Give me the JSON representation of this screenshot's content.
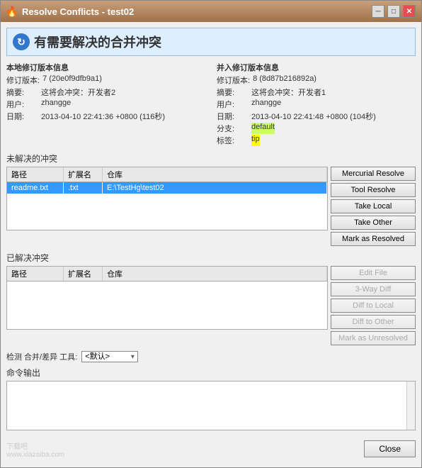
{
  "window": {
    "title": "Resolve Conflicts - test02",
    "minimize_label": "─",
    "maximize_label": "□",
    "close_label": "✕"
  },
  "header": {
    "icon": "↻",
    "title": "有需要解决的合并冲突"
  },
  "local_info": {
    "title": "本地修订版本信息",
    "revision_label": "修订版本:",
    "revision_value": "7 (20e0f9dfb9a1)",
    "summary_label": "摘要:",
    "summary_value": "这将会冲突：开发者2",
    "user_label": "用户:",
    "user_value": "zhangge",
    "date_label": "日期:",
    "date_value": "2013-04-10 22:41:36 +0800 (116秒)"
  },
  "merge_info": {
    "title": "并入修订版本信息",
    "revision_label": "修订版本:",
    "revision_value": "8 (8d87b216892a)",
    "summary_label": "摘要:",
    "summary_value": "这将会冲突：开发者1",
    "user_label": "用户:",
    "user_value": "zhangge",
    "date_label": "日期:",
    "date_value": "2013-04-10 22:41:48 +0800 (104秒)",
    "branch_label": "分支:",
    "branch_value": "default",
    "tag_label": "标签:",
    "tag_value": "tip"
  },
  "unresolved_section": {
    "label": "未解决的冲突",
    "table_headers": [
      "路径",
      "扩展名",
      "仓库"
    ],
    "rows": [
      {
        "path": "readme.txt",
        "ext": ".txt",
        "repo": "E:\\TestHg\\test02",
        "selected": true
      }
    ],
    "buttons": {
      "mercurial_resolve": "Mercurial Resolve",
      "tool_resolve": "Tool Resolve",
      "take_local": "Take Local",
      "take_other": "Take Other",
      "mark_resolved": "Mark as Resolved"
    }
  },
  "resolved_section": {
    "label": "已解决冲突",
    "table_headers": [
      "路径",
      "扩展名",
      "仓库"
    ],
    "rows": [],
    "buttons": {
      "edit_file": "Edit File",
      "three_way_diff": "3-Way Diff",
      "diff_to_local": "Diff to Local",
      "diff_to_other": "Diff to Other",
      "mark_unresolved": "Mark as Unresolved"
    }
  },
  "toolbar": {
    "detect_label": "检测 合并/差异 工具:",
    "tool_select_value": "<默认>",
    "tool_options": [
      "<默认>"
    ]
  },
  "output": {
    "label": "命令输出"
  },
  "footer": {
    "close_label": "Close"
  }
}
